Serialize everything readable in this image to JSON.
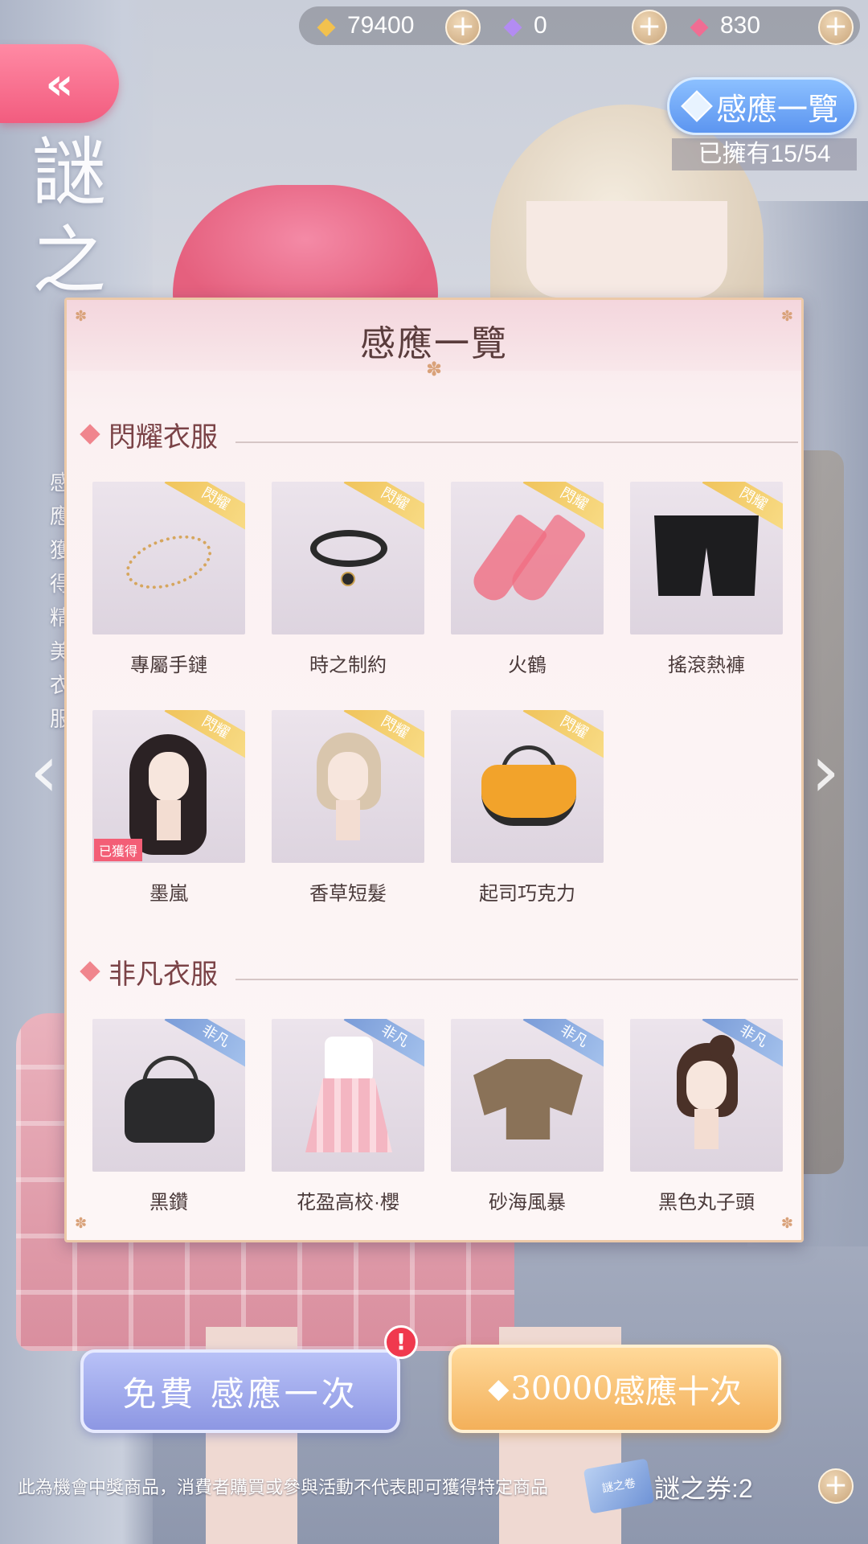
{
  "background": {
    "vertical_title": "謎之",
    "vertical_desc": "感應獲得精美衣服"
  },
  "currency": [
    {
      "icon": "coin-icon",
      "value": "79400"
    },
    {
      "icon": "purple-diamond-icon",
      "value": "0"
    },
    {
      "icon": "pink-diamond-icon",
      "value": "830"
    }
  ],
  "overview_button_label": "感應一覽",
  "owned_count": "已擁有15/54",
  "panel": {
    "title": "感應一覽",
    "sections": [
      {
        "title": "閃耀衣服",
        "badge": "閃耀",
        "items": [
          {
            "name": "專屬手鏈",
            "obtained": false
          },
          {
            "name": "時之制約",
            "obtained": false
          },
          {
            "name": "火鶴",
            "obtained": false
          },
          {
            "name": "搖滾熱褲",
            "obtained": false
          },
          {
            "name": "墨嵐",
            "obtained": true
          },
          {
            "name": "香草短髮",
            "obtained": false
          },
          {
            "name": "起司巧克力",
            "obtained": false
          }
        ]
      },
      {
        "title": "非凡衣服",
        "badge": "非凡",
        "items": [
          {
            "name": "黑鑽",
            "obtained": false
          },
          {
            "name": "花盈高校·櫻",
            "obtained": false
          },
          {
            "name": "砂海風暴",
            "obtained": false
          },
          {
            "name": "黑色丸子頭",
            "obtained": false
          }
        ]
      }
    ],
    "obtained_label": "已獲得"
  },
  "buttons": {
    "free_label": "免費 感應一次",
    "alert": "!",
    "ten_cost": "30000",
    "ten_label": "感應十次"
  },
  "footer": {
    "disclaimer": "此為機會中獎商品，消費者購買或參與活動不代表即可獲得特定商品",
    "ticket_label": "謎之卷",
    "ticket_count": "謎之券:2"
  },
  "colors": {
    "accent_pink": "#f25c7f",
    "accent_blue": "#5c95f0",
    "accent_gold": "#f3b05a"
  }
}
